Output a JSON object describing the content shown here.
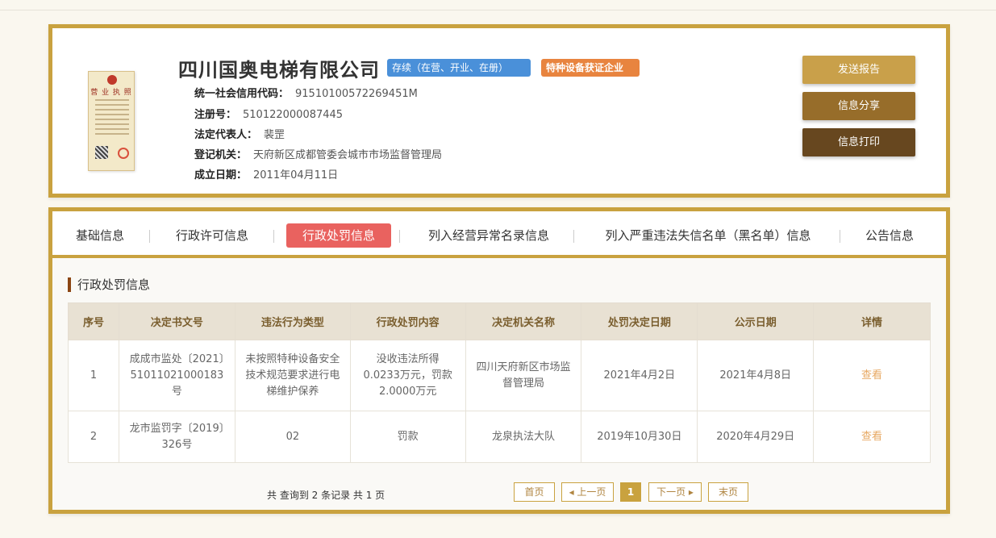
{
  "company": {
    "name": "四川国奥电梯有限公司",
    "status_tag": "存续（在营、开业、在册）",
    "special_tag": "特种设备获证企业",
    "license_title": "营 业 执 照",
    "fields": [
      {
        "label": "统一社会信用代码：",
        "value": "91510100572269451M"
      },
      {
        "label": "注册号：",
        "value": "510122000087445"
      },
      {
        "label": "法定代表人：",
        "value": "裴罡"
      },
      {
        "label": "登记机关：",
        "value": "天府新区成都管委会城市市场监督管理局"
      },
      {
        "label": "成立日期：",
        "value": "2011年04月11日"
      }
    ]
  },
  "actions": {
    "report": "发送报告",
    "share": "信息分享",
    "print": "信息打印"
  },
  "tabs": [
    {
      "label": "基础信息",
      "active": false
    },
    {
      "label": "行政许可信息",
      "active": false
    },
    {
      "label": "行政处罚信息",
      "active": true
    },
    {
      "label": "列入经营异常名录信息",
      "active": false
    },
    {
      "label": "列入严重违法失信名单（黑名单）信息",
      "active": false
    },
    {
      "label": "公告信息",
      "active": false
    }
  ],
  "section_title": "行政处罚信息",
  "table": {
    "headers": [
      "序号",
      "决定书文号",
      "违法行为类型",
      "行政处罚内容",
      "决定机关名称",
      "处罚决定日期",
      "公示日期",
      "详情"
    ],
    "rows": [
      [
        "1",
        "成成市监处〔2021〕51011021000183号",
        "未按照特种设备安全技术规范要求进行电梯维护保养",
        "没收违法所得0.0233万元，罚款2.0000万元",
        "四川天府新区市场监督管理局",
        "2021年4月2日",
        "2021年4月8日",
        "查看"
      ],
      [
        "2",
        "龙市监罚字〔2019〕326号",
        "02",
        "罚款",
        "龙泉执法大队",
        "2019年10月30日",
        "2020年4月29日",
        "查看"
      ]
    ]
  },
  "pagination": {
    "summary": "共 查询到 2 条记录 共 1 页",
    "first": "首页",
    "prev": "◂ 上一页",
    "current": "1",
    "next": "下一页 ▸",
    "last": "末页"
  },
  "colors": {
    "frame": "#c9a23f",
    "active_tab": "#e9625f",
    "status_tag": "#4a90d9",
    "special_tag": "#e8843f",
    "link": "#e7a862"
  }
}
